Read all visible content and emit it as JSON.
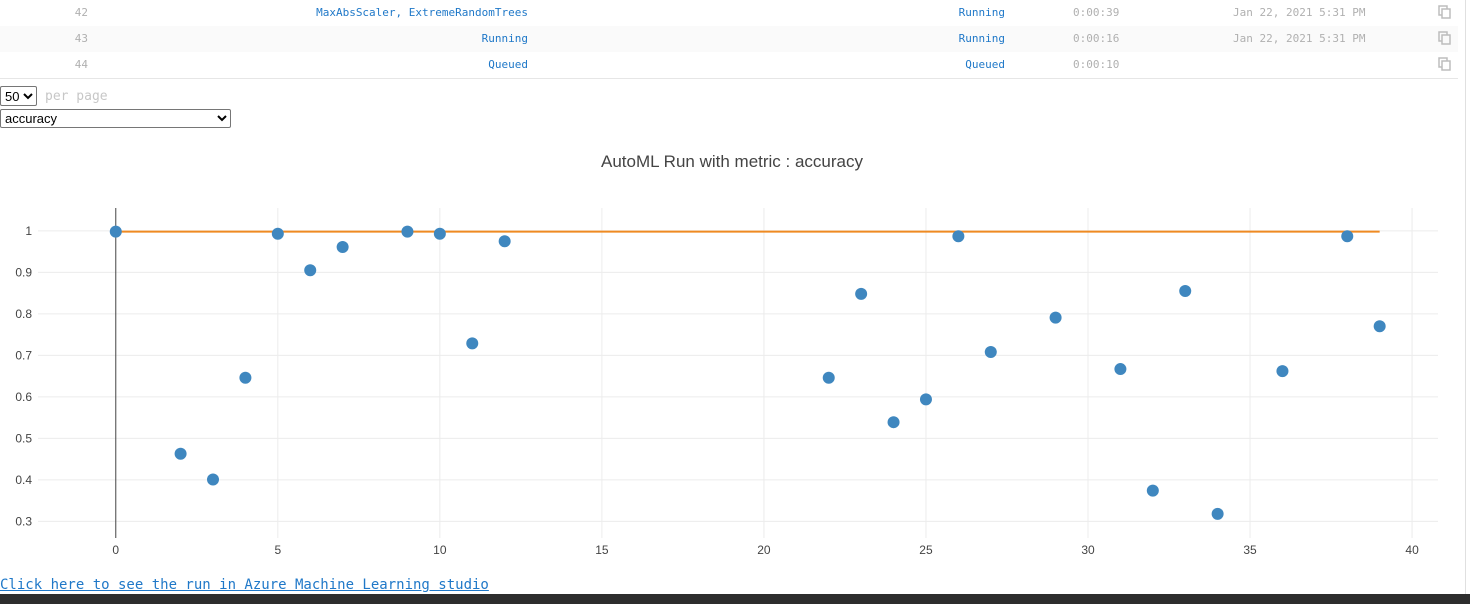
{
  "runs": [
    {
      "id": "42",
      "name": "MaxAbsScaler, ExtremeRandomTrees",
      "status": "Running",
      "duration": "0:00:39",
      "date": "Jan 22, 2021 5:31 PM",
      "icon": "copy-icon"
    },
    {
      "id": "43",
      "name": "Running",
      "status": "Running",
      "duration": "0:00:16",
      "date": "Jan 22, 2021 5:31 PM",
      "icon": "copy-icon"
    },
    {
      "id": "44",
      "name": "Queued",
      "status": "Queued",
      "duration": "0:00:10",
      "date": "",
      "icon": "copy-icon"
    }
  ],
  "pagination": {
    "page_size": "50",
    "per_page_label": "per page"
  },
  "metric_selector": {
    "value": "accuracy"
  },
  "chart_data": {
    "type": "scatter",
    "title": "AutoML Run with metric : accuracy",
    "xlim": [
      -2.4,
      40.8
    ],
    "ylim": [
      0.26,
      1.055
    ],
    "xticks": [
      0,
      5,
      10,
      15,
      20,
      25,
      30,
      35,
      40
    ],
    "yticks": [
      1,
      0.9,
      0.8,
      0.7,
      0.6,
      0.5,
      0.4,
      0.3
    ],
    "ytick_labels": [
      "1",
      "0.9",
      "0.8",
      "0.7",
      "0.6",
      "0.5",
      "0.4",
      "0.3"
    ],
    "grid": true,
    "series": [
      {
        "kind": "markers",
        "color": "#3f87bf",
        "x": [
          0,
          2,
          3,
          4,
          5,
          6,
          7,
          9,
          10,
          11,
          12,
          22,
          23,
          24,
          25,
          26,
          27,
          29,
          31,
          32,
          33,
          34,
          36,
          38,
          39
        ],
        "y": [
          0.998,
          0.463,
          0.401,
          0.646,
          0.993,
          0.905,
          0.961,
          0.998,
          0.993,
          0.729,
          0.975,
          0.646,
          0.848,
          0.539,
          0.594,
          0.987,
          0.708,
          0.791,
          0.667,
          0.374,
          0.855,
          0.318,
          0.662,
          0.987,
          0.77
        ]
      },
      {
        "kind": "line",
        "color": "#ef8a22",
        "x": [
          0,
          39
        ],
        "y": [
          0.998,
          0.998
        ]
      }
    ]
  },
  "link": {
    "text": "Click here to see the run in Azure Machine Learning studio"
  }
}
